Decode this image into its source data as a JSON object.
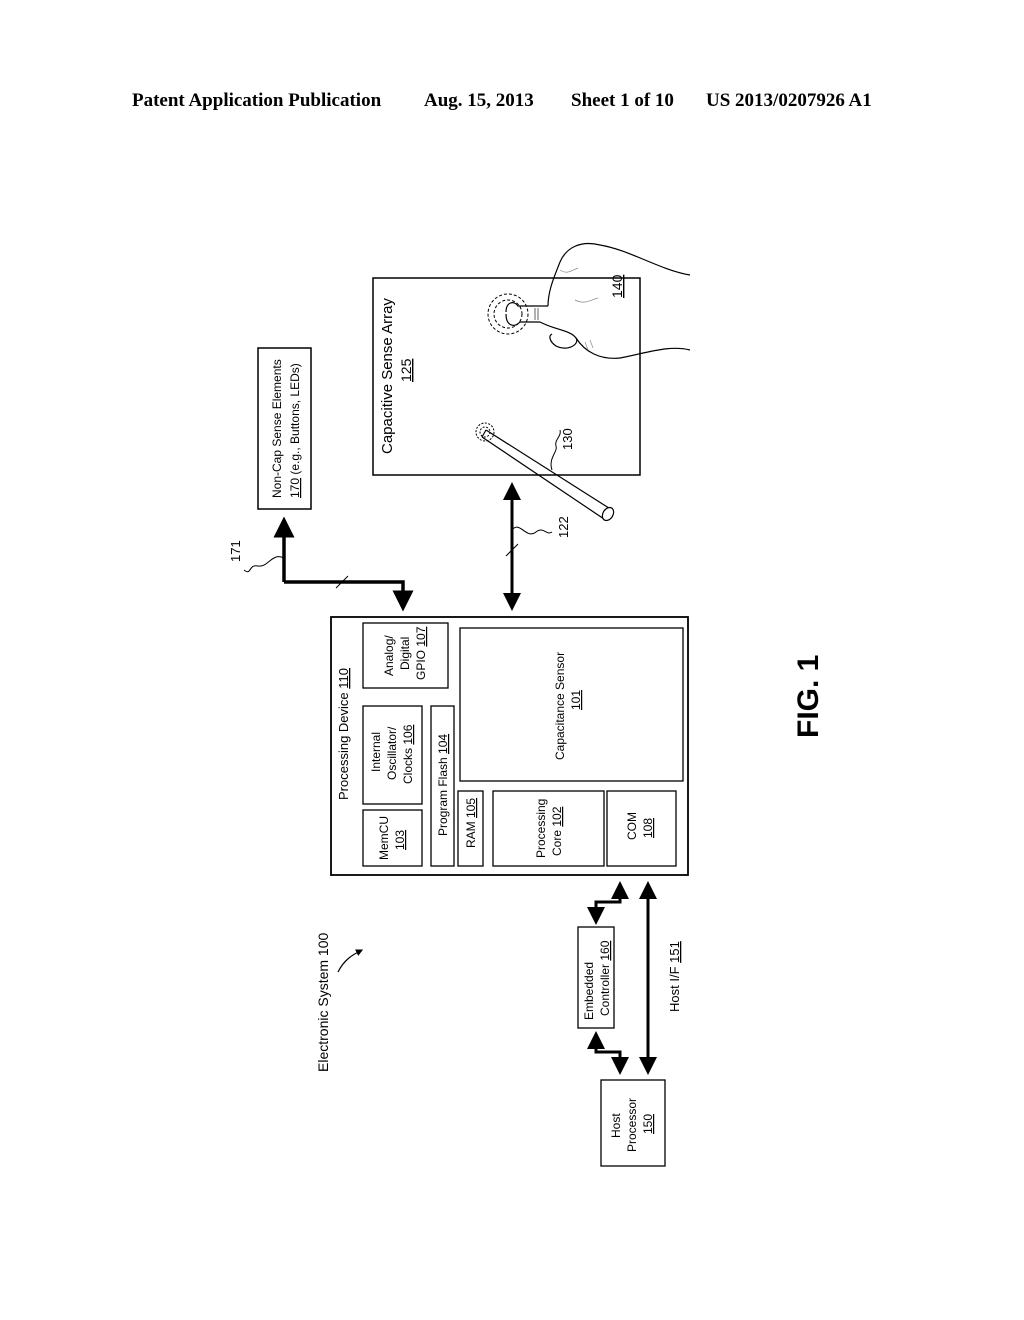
{
  "header": {
    "publication": "Patent Application Publication",
    "date": "Aug. 15, 2013",
    "sheet": "Sheet 1 of 10",
    "number": "US 2013/0207926 A1"
  },
  "figure": {
    "label": "FIG. 1",
    "system": {
      "text": "Electronic System 100"
    },
    "non_cap": {
      "line1": "Non-Cap Sense Elements",
      "ref": "170",
      "line2_rest": " (e.g., Buttons, LEDs)"
    },
    "bus_171": "171",
    "bus_122": "122",
    "cap_array": {
      "line1": "Capacitive Sense  Array",
      "ref": "125"
    },
    "stylus_ref": "130",
    "hand_ref": "140",
    "processing_device": {
      "text": "Processing Device ",
      "ref": "110"
    },
    "gpio": {
      "line1": "Analog/",
      "line2": "Digital",
      "line3": "GPIO ",
      "ref": "107"
    },
    "osc": {
      "line1": "Internal",
      "line2": "Oscillator/",
      "line3": "Clocks ",
      "ref": "106"
    },
    "memcu": {
      "line1": "MemCU",
      "ref": "103"
    },
    "flash": {
      "text": "Program Flash ",
      "ref": "104"
    },
    "ram": {
      "text": "RAM ",
      "ref": "105"
    },
    "cap_sensor": {
      "line1": "Capacitance Sensor",
      "ref": "101"
    },
    "core": {
      "line1": "Processing",
      "line2": "Core ",
      "ref": "102"
    },
    "com": {
      "line1": "COM",
      "ref": "108"
    },
    "embedded": {
      "line1": "Embedded",
      "line2": "Controller ",
      "ref": "160"
    },
    "host_if": {
      "text": "Host I/F ",
      "ref": "151"
    },
    "host": {
      "line1": "Host",
      "line2": "Processor",
      "ref": "150"
    }
  }
}
